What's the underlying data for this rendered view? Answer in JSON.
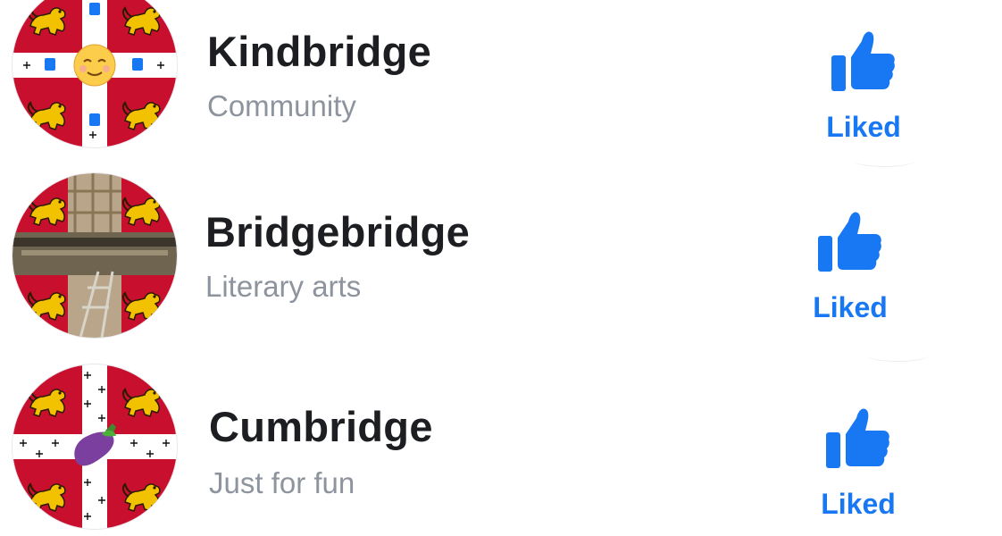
{
  "pages": [
    {
      "name": "Kindbridge",
      "category": "Community",
      "button_label": "Liked",
      "avatar_overlay": "relieved-face-emoji"
    },
    {
      "name": "Bridgebridge",
      "category": "Literary arts",
      "button_label": "Liked",
      "avatar_overlay": "bridge-photo"
    },
    {
      "name": "Cumbridge",
      "category": "Just for fun",
      "button_label": "Liked",
      "avatar_overlay": "eggplant-emoji"
    }
  ],
  "colors": {
    "accent": "#1877f2",
    "name_text": "#1c1e21",
    "category_text": "#8d949e",
    "crest_red": "#c8102e",
    "crest_gold": "#f2c200"
  },
  "icons": {
    "like": "thumbs-up-icon"
  }
}
